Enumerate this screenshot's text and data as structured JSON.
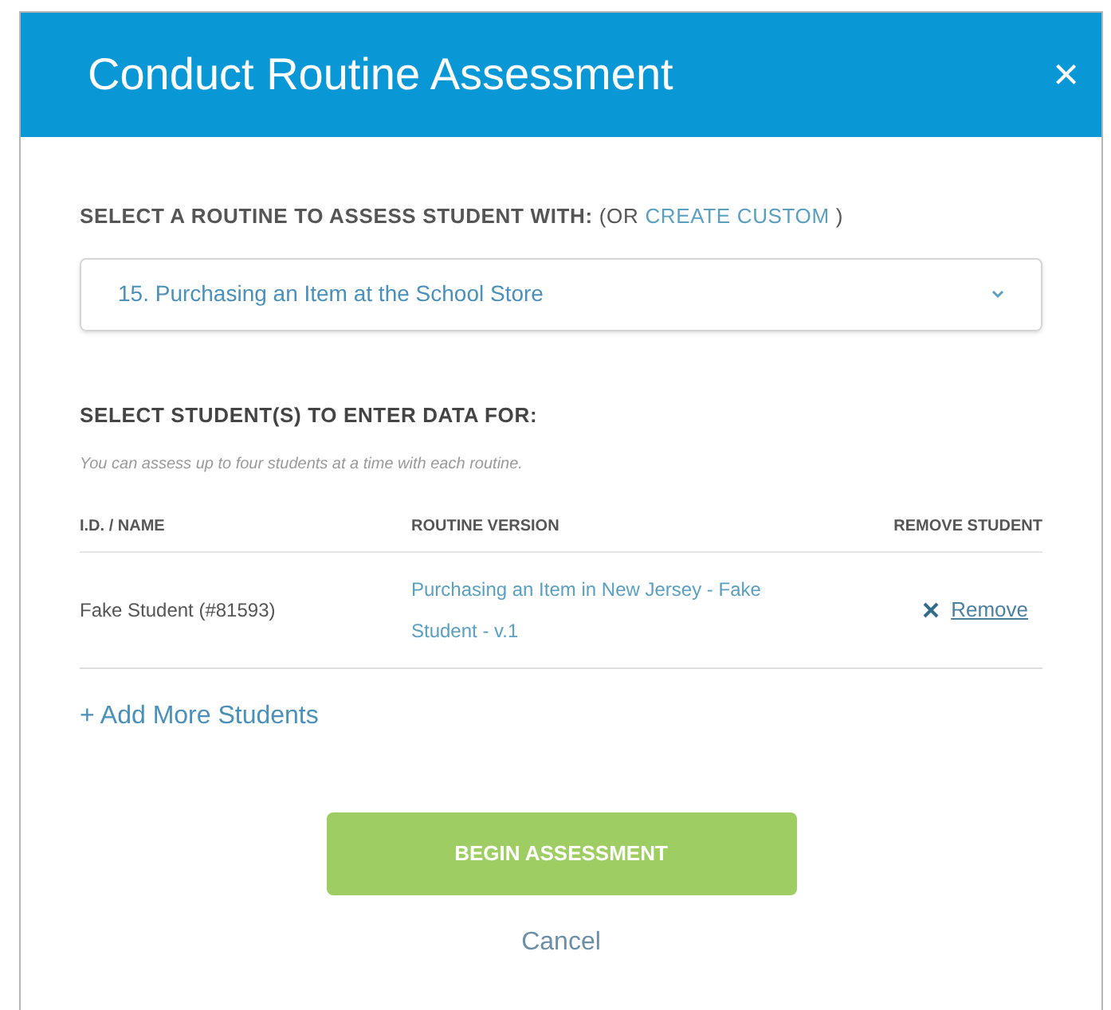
{
  "dialog": {
    "title": "Conduct Routine Assessment",
    "close": "×"
  },
  "routine": {
    "label": "SELECT A ROUTINE TO ASSESS STUDENT WITH:",
    "label_suffix_open": "(OR",
    "link": "CREATE CUSTOM",
    "label_suffix_close": ")",
    "value": "15. Purchasing an Item at the School Store"
  },
  "students": {
    "heading": "SELECT STUDENT(S) TO ENTER DATA FOR:",
    "note": "You can assess up to four students at a time with each routine.",
    "columns": [
      "I.D. / NAME",
      "ROUTINE VERSION",
      "REMOVE STUDENT"
    ],
    "rows": [
      {
        "name": "Fake Student (#81593)",
        "version": "Purchasing an Item in New Jersey - Fake Student - v.1",
        "remove": "Remove"
      }
    ],
    "add": "+ Add More Students"
  },
  "buttons": {
    "begin": "BEGIN ASSESSMENT",
    "cancel": "Cancel"
  }
}
